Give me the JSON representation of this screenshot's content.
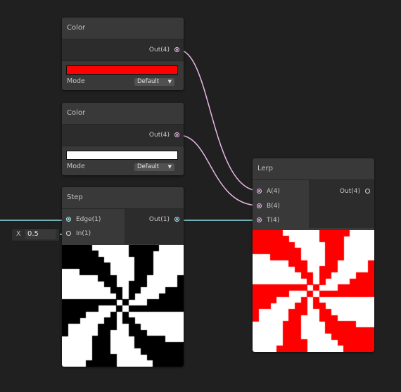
{
  "nodes": {
    "color1": {
      "title": "Color",
      "out_label": "Out(4)",
      "swatch": "#ff0000",
      "mode_label": "Mode",
      "mode_value": "Default"
    },
    "color2": {
      "title": "Color",
      "out_label": "Out(4)",
      "swatch": "#ffffff",
      "mode_label": "Mode",
      "mode_value": "Default"
    },
    "step": {
      "title": "Step",
      "inputs": [
        "Edge(1)",
        "In(1)"
      ],
      "out_label": "Out(1)"
    },
    "lerp": {
      "title": "Lerp",
      "inputs": [
        "A(4)",
        "B(4)",
        "T(4)"
      ],
      "out_label": "Out(4)"
    }
  },
  "inline_input": {
    "axis": "X",
    "value": "0.5"
  },
  "colors": {
    "canvas": "#202020",
    "node_body": "#393939",
    "edge_color": "#e6b8e4",
    "edge_float": "#8fe0ea",
    "preview_fg_step": "#000000",
    "preview_fg_lerp": "#ff0000",
    "preview_bg": "#ffffff"
  },
  "icons": {
    "chevron": "chevron-down-icon",
    "port": "port-icon"
  }
}
